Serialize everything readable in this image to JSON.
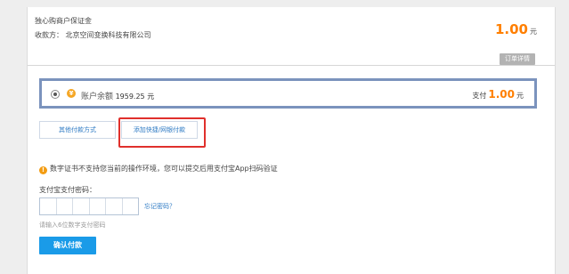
{
  "order": {
    "title": "独心购商户保证金",
    "payee": "收款方： 北京空间变换科技有限公司",
    "amount": "1.00",
    "unit": "元",
    "detail_label": "订单详情"
  },
  "balance": {
    "icon_glyph": "¥",
    "label_title": "账户余额",
    "balance_value": "1959.25 元",
    "pay_prefix": "支付",
    "pay_amount": "1.00",
    "pay_unit": "元"
  },
  "methods": {
    "other_label": "其他付款方式",
    "add_card_label": "添加快捷/网银付款"
  },
  "notice": {
    "icon_glyph": "!",
    "text": "数字证书不支持您当前的操作环境，您可以提交后用支付宝App扫码验证"
  },
  "password": {
    "label": "支付宝支付密码：",
    "forgot": "忘记密码？",
    "hint": "请输入6位数字支付密码",
    "cells": 6
  },
  "confirm": {
    "label": "确认付款"
  },
  "colors": {
    "accent_orange": "#ff7f00",
    "link_blue": "#2f7bc4",
    "button_blue": "#1a9be8",
    "highlight_red": "#e0302c",
    "selected_border": "#7b93bd"
  }
}
